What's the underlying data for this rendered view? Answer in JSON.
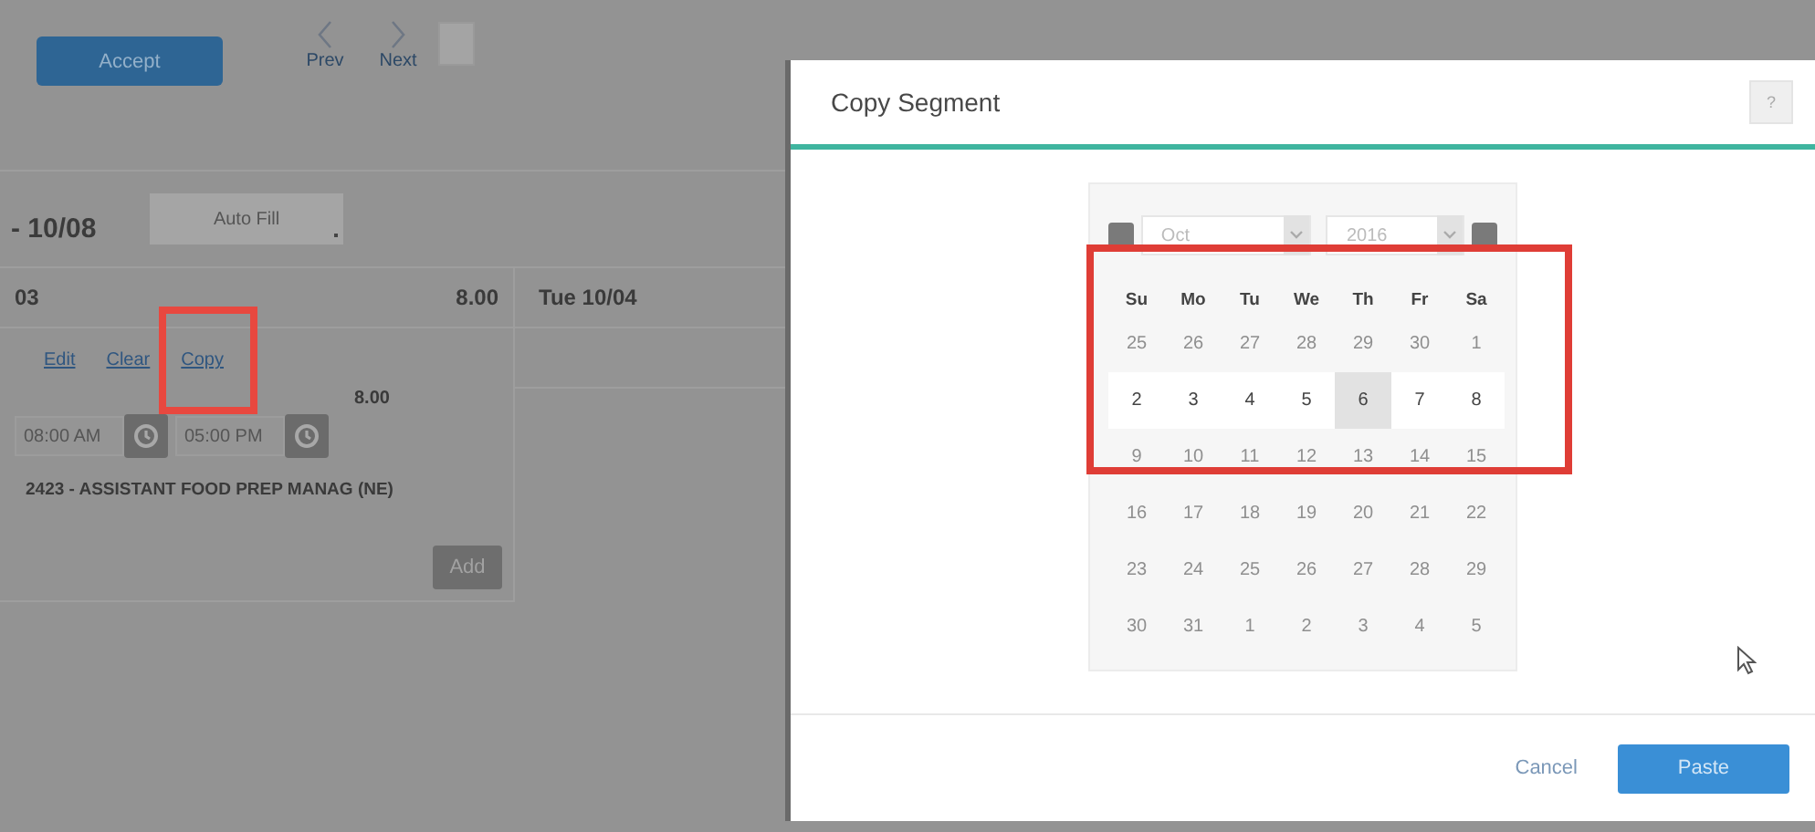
{
  "toolbar": {
    "accept_button": "Accept",
    "nav": [
      {
        "label": "Prev"
      },
      {
        "label": "Next"
      }
    ]
  },
  "schedule": {
    "date_range": "- 10/08",
    "auto_fill_button": "Auto Fill",
    "columns": [
      {
        "day": "03",
        "hours": "8.00"
      },
      {
        "day": "Tue 10/04"
      }
    ],
    "segment": {
      "actions": [
        "Edit",
        "Clear",
        "Copy"
      ],
      "hours": "8.00",
      "start": "08:00 AM",
      "end": "05:00 PM",
      "job": "2423 - ASSISTANT FOOD PREP MANAG (NE)",
      "add_button": "Add"
    }
  },
  "dialog": {
    "title": "Copy Segment",
    "help_button": "?",
    "calendar": {
      "month": "Oct",
      "year": "2016",
      "weekdays": [
        "Su",
        "Mo",
        "Tu",
        "We",
        "Th",
        "Fr",
        "Sa"
      ],
      "weeks": [
        [
          {
            "day": "25",
            "disabled": true,
            "selected": false
          },
          {
            "day": "26",
            "disabled": true,
            "selected": false
          },
          {
            "day": "27",
            "disabled": true,
            "selected": false
          },
          {
            "day": "28",
            "disabled": true,
            "selected": false
          },
          {
            "day": "29",
            "disabled": true,
            "selected": false
          },
          {
            "day": "30",
            "disabled": true,
            "selected": false
          },
          {
            "day": "1",
            "disabled": true,
            "selected": false
          }
        ],
        [
          {
            "day": "2",
            "disabled": false,
            "selected": false
          },
          {
            "day": "3",
            "disabled": false,
            "selected": false
          },
          {
            "day": "4",
            "disabled": false,
            "selected": false
          },
          {
            "day": "5",
            "disabled": false,
            "selected": false
          },
          {
            "day": "6",
            "disabled": false,
            "selected": true
          },
          {
            "day": "7",
            "disabled": false,
            "selected": false
          },
          {
            "day": "8",
            "disabled": false,
            "selected": false
          }
        ],
        [
          {
            "day": "9",
            "disabled": true,
            "selected": false
          },
          {
            "day": "10",
            "disabled": true,
            "selected": false
          },
          {
            "day": "11",
            "disabled": true,
            "selected": false
          },
          {
            "day": "12",
            "disabled": true,
            "selected": false
          },
          {
            "day": "13",
            "disabled": true,
            "selected": false
          },
          {
            "day": "14",
            "disabled": true,
            "selected": false
          },
          {
            "day": "15",
            "disabled": true,
            "selected": false
          }
        ],
        [
          {
            "day": "16",
            "disabled": true,
            "selected": false
          },
          {
            "day": "17",
            "disabled": true,
            "selected": false
          },
          {
            "day": "18",
            "disabled": true,
            "selected": false
          },
          {
            "day": "19",
            "disabled": true,
            "selected": false
          },
          {
            "day": "20",
            "disabled": true,
            "selected": false
          },
          {
            "day": "21",
            "disabled": true,
            "selected": false
          },
          {
            "day": "22",
            "disabled": true,
            "selected": false
          }
        ],
        [
          {
            "day": "23",
            "disabled": true,
            "selected": false
          },
          {
            "day": "24",
            "disabled": true,
            "selected": false
          },
          {
            "day": "25",
            "disabled": true,
            "selected": false
          },
          {
            "day": "26",
            "disabled": true,
            "selected": false
          },
          {
            "day": "27",
            "disabled": true,
            "selected": false
          },
          {
            "day": "28",
            "disabled": true,
            "selected": false
          },
          {
            "day": "29",
            "disabled": true,
            "selected": false
          }
        ],
        [
          {
            "day": "30",
            "disabled": true,
            "selected": false
          },
          {
            "day": "31",
            "disabled": true,
            "selected": false
          },
          {
            "day": "1",
            "disabled": true,
            "selected": false
          },
          {
            "day": "2",
            "disabled": true,
            "selected": false
          },
          {
            "day": "3",
            "disabled": true,
            "selected": false
          },
          {
            "day": "4",
            "disabled": true,
            "selected": false
          },
          {
            "day": "5",
            "disabled": true,
            "selected": false
          }
        ]
      ]
    },
    "buttons": [
      {
        "label": "Cancel",
        "kind": "link"
      },
      {
        "label": "Paste",
        "kind": "primary"
      }
    ]
  }
}
